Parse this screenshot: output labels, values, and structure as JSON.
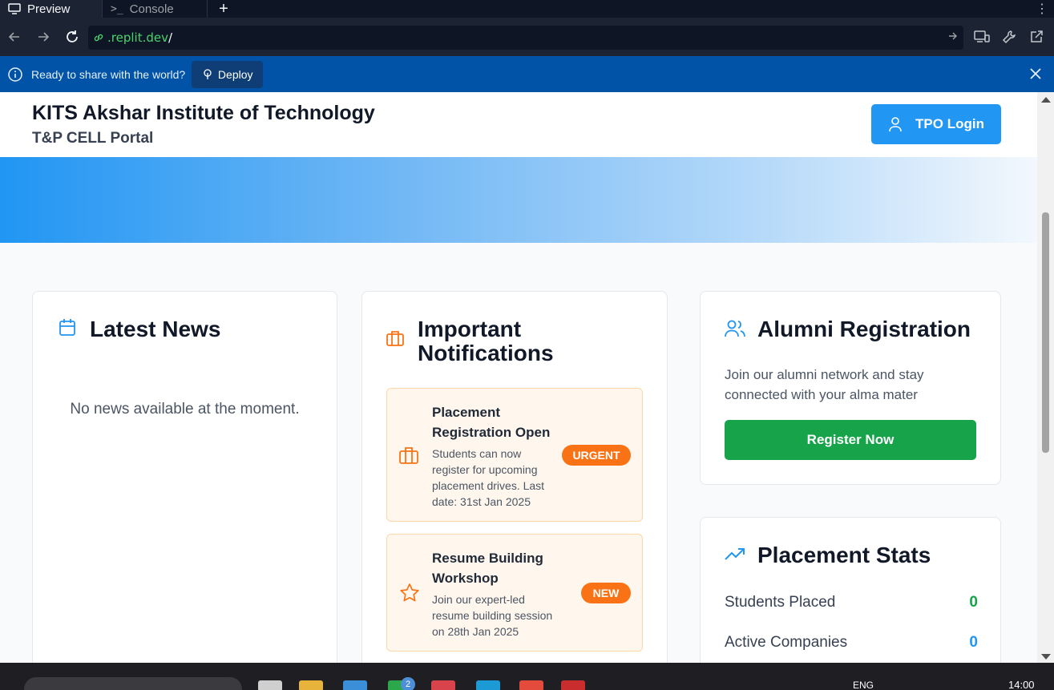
{
  "ide": {
    "tabs": [
      {
        "label": "Preview"
      },
      {
        "label": "Console"
      }
    ],
    "url": {
      "domain": ".replit.dev",
      "path": "/"
    },
    "deploy_banner": {
      "message": "Ready to share with the world?",
      "button": "Deploy"
    }
  },
  "site": {
    "institute_name": "KITS Akshar Institute of Technology",
    "portal_name": "T&P CELL Portal",
    "tpo_button": "TPO Login"
  },
  "news": {
    "title": "Latest News",
    "empty_message": "No news available at the moment."
  },
  "notifications": {
    "title_line1": "Important",
    "title_line2": "Notifications",
    "items": [
      {
        "title": "Placement Registration Open",
        "description": "Students can now register for upcoming placement drives. Last date: 31st Jan 2025",
        "badge": "URGENT",
        "icon": "briefcase-icon"
      },
      {
        "title": "Resume Building Workshop",
        "description": "Join our expert-led resume building session on 28th Jan 2025",
        "badge": "NEW",
        "icon": "star-icon"
      }
    ]
  },
  "alumni": {
    "title": "Alumni Registration",
    "description": "Join our alumni network and stay connected with your alma mater",
    "button": "Register Now"
  },
  "stats": {
    "title": "Placement Stats",
    "rows": [
      {
        "label": "Students Placed",
        "value": "0",
        "color": "#16a34a"
      },
      {
        "label": "Active Companies",
        "value": "0",
        "color": "#2196f3"
      }
    ]
  },
  "taskbar": {
    "badge_count": "2",
    "language": "ENG",
    "time": "14:00"
  },
  "colors": {
    "primary": "#2196f3",
    "success": "#16a34a",
    "warning": "#f97316",
    "deploy_banner": "#0053a6"
  }
}
